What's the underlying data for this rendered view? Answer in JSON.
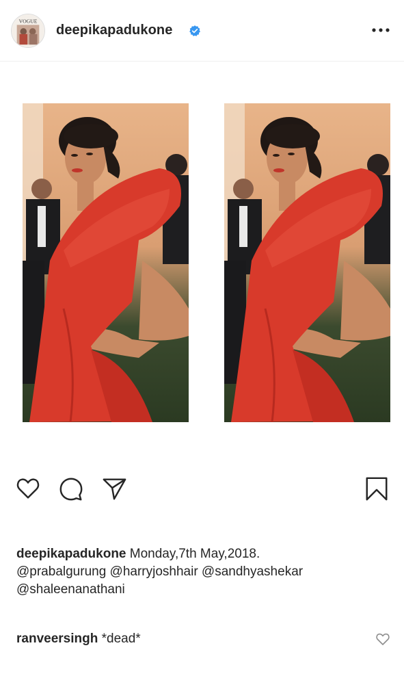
{
  "post": {
    "username": "deepikapadukone",
    "verified": true,
    "avatar_text": "VOGUE",
    "menu_icon": "more-horizontal-icon",
    "images": [
      {
        "alt": "photo-left"
      },
      {
        "alt": "photo-right"
      }
    ]
  },
  "actions": {
    "like_icon": "heart-outline-icon",
    "comment_icon": "comment-bubble-icon",
    "share_icon": "paper-plane-icon",
    "save_icon": "bookmark-icon"
  },
  "caption": {
    "username": "deepikapadukone",
    "text": " Monday,7th May,2018.",
    "line2": "@prabalgurung @harryjoshhair @sandhyashekar",
    "line3": "@shaleenanathani"
  },
  "comment": {
    "username": "ranveersingh",
    "text": " *dead*"
  },
  "colors": {
    "text": "#262626",
    "verified": "#3897f0",
    "divider": "#efefef",
    "dress": "#d83a2b"
  }
}
